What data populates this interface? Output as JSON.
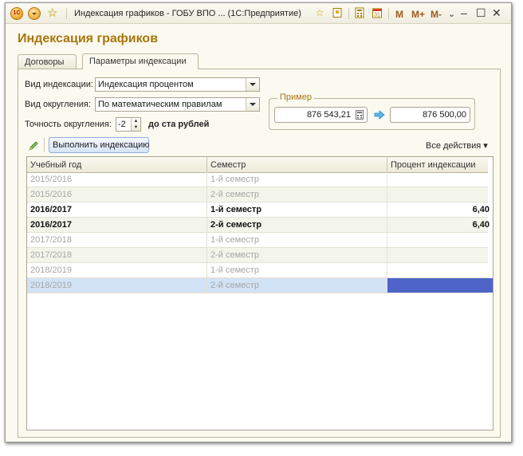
{
  "window": {
    "title": "Индексация графиков - ГОБУ ВПО ...  (1С:Предприятие)",
    "logo": "1С",
    "m_buttons": [
      "M",
      "M+",
      "M-"
    ]
  },
  "form": {
    "heading": "Индексация графиков",
    "tabs": [
      {
        "label": "Договоры",
        "active": false
      },
      {
        "label": "Параметры индексации",
        "active": true
      }
    ]
  },
  "params": {
    "index_type_label": "Вид индексации:",
    "index_type_value": "Индексация процентом",
    "rounding_type_label": "Вид округления:",
    "rounding_type_value": "По математическим правилам",
    "precision_label": "Точность округления:",
    "precision_value": "-2",
    "precision_suffix": "до ста рублей"
  },
  "example": {
    "legend": "Пример",
    "input_value": "876 543,21",
    "output_value": "876 500,00"
  },
  "toolbar": {
    "run_label": "Выполнить индексацию",
    "all_actions_label": "Все действия ▾"
  },
  "table": {
    "headers": [
      "Учебный год",
      "Семестр",
      "Процент индексации"
    ],
    "rows": [
      {
        "year": "2015/2016",
        "semester": "1-й семестр",
        "percent": "",
        "style": "gray"
      },
      {
        "year": "2015/2016",
        "semester": "2-й семестр",
        "percent": "",
        "style": "gray"
      },
      {
        "year": "2016/2017",
        "semester": "1-й семестр",
        "percent": "6,40",
        "style": "bold"
      },
      {
        "year": "2016/2017",
        "semester": "2-й семестр",
        "percent": "6,40",
        "style": "bold"
      },
      {
        "year": "2017/2018",
        "semester": "1-й семестр",
        "percent": "",
        "style": "gray"
      },
      {
        "year": "2017/2018",
        "semester": "2-й семестр",
        "percent": "",
        "style": "gray"
      },
      {
        "year": "2018/2019",
        "semester": "1-й семестр",
        "percent": "",
        "style": "gray"
      },
      {
        "year": "2018/2019",
        "semester": "2-й семестр",
        "percent": "",
        "style": "gray selected"
      }
    ]
  },
  "colors": {
    "heading": "#a8760a",
    "selection_row": "#d2e3f6",
    "selection_cell": "#4e64c9"
  }
}
